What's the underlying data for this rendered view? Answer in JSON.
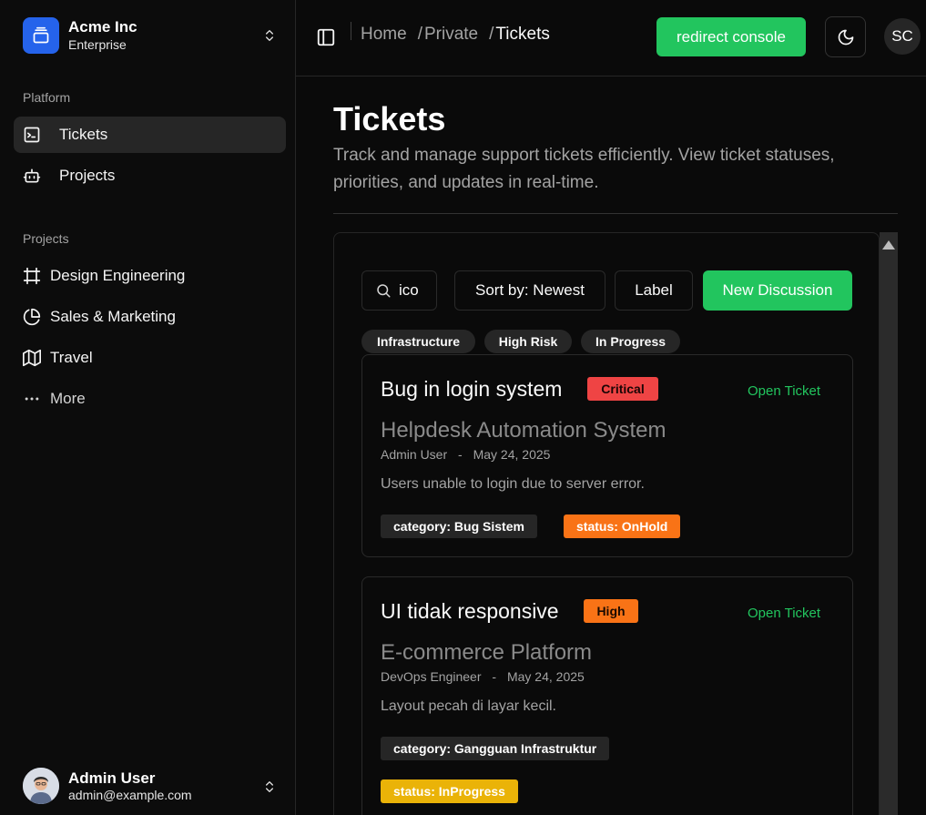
{
  "sidebar": {
    "team": {
      "name": "Acme Inc",
      "plan": "Enterprise"
    },
    "platform_label": "Platform",
    "platform_items": [
      {
        "label": "Tickets",
        "icon": "terminal-square-icon",
        "active": true
      },
      {
        "label": "Projects",
        "icon": "bot-icon",
        "active": false
      }
    ],
    "projects_label": "Projects",
    "project_items": [
      {
        "label": "Design Engineering",
        "icon": "frame-icon"
      },
      {
        "label": "Sales & Marketing",
        "icon": "pie-chart-icon"
      },
      {
        "label": "Travel",
        "icon": "map-icon"
      },
      {
        "label": "More",
        "icon": "more-horizontal-icon"
      }
    ],
    "user": {
      "name": "Admin User",
      "email": "admin@example.com"
    }
  },
  "header": {
    "breadcrumb": [
      "Home",
      "Private",
      "Tickets"
    ],
    "breadcrumb_separator": "/",
    "redirect_label": "redirect console",
    "avatar_initials": "SC"
  },
  "main": {
    "title": "Tickets",
    "description": "Track and manage support tickets efficiently. View ticket statuses, priorities, and updates in real-time."
  },
  "toolbar": {
    "search_value": "ico",
    "sort_label": "Sort by: Newest",
    "label_button": "Label",
    "new_discussion": "New Discussion"
  },
  "filters": [
    "Infrastructure",
    "High Risk",
    "In Progress"
  ],
  "tickets": [
    {
      "title": "Bug in login system",
      "priority": "Critical",
      "priority_color": "#ef4444",
      "open_label": "Open Ticket",
      "project": "Helpdesk Automation System",
      "author": "Admin User",
      "meta_sep": "-",
      "date": "May 24, 2025",
      "description": "Users unable to login due to server error.",
      "category": "category: Bug Sistem",
      "status": "status: OnHold",
      "status_color": "#f97316"
    },
    {
      "title": "UI tidak responsive",
      "priority": "High",
      "priority_color": "#f97316",
      "open_label": "Open Ticket",
      "project": "E-commerce Platform",
      "author": "DevOps Engineer",
      "meta_sep": "-",
      "date": "May 24, 2025",
      "description": "Layout pecah di layar kecil.",
      "category": "category: Gangguan Infrastruktur",
      "status": "status: InProgress",
      "status_color": "#eab308"
    }
  ],
  "colors": {
    "accent_green": "#22c55e",
    "background": "#0a0a0a",
    "team_logo": "#2563eb"
  }
}
